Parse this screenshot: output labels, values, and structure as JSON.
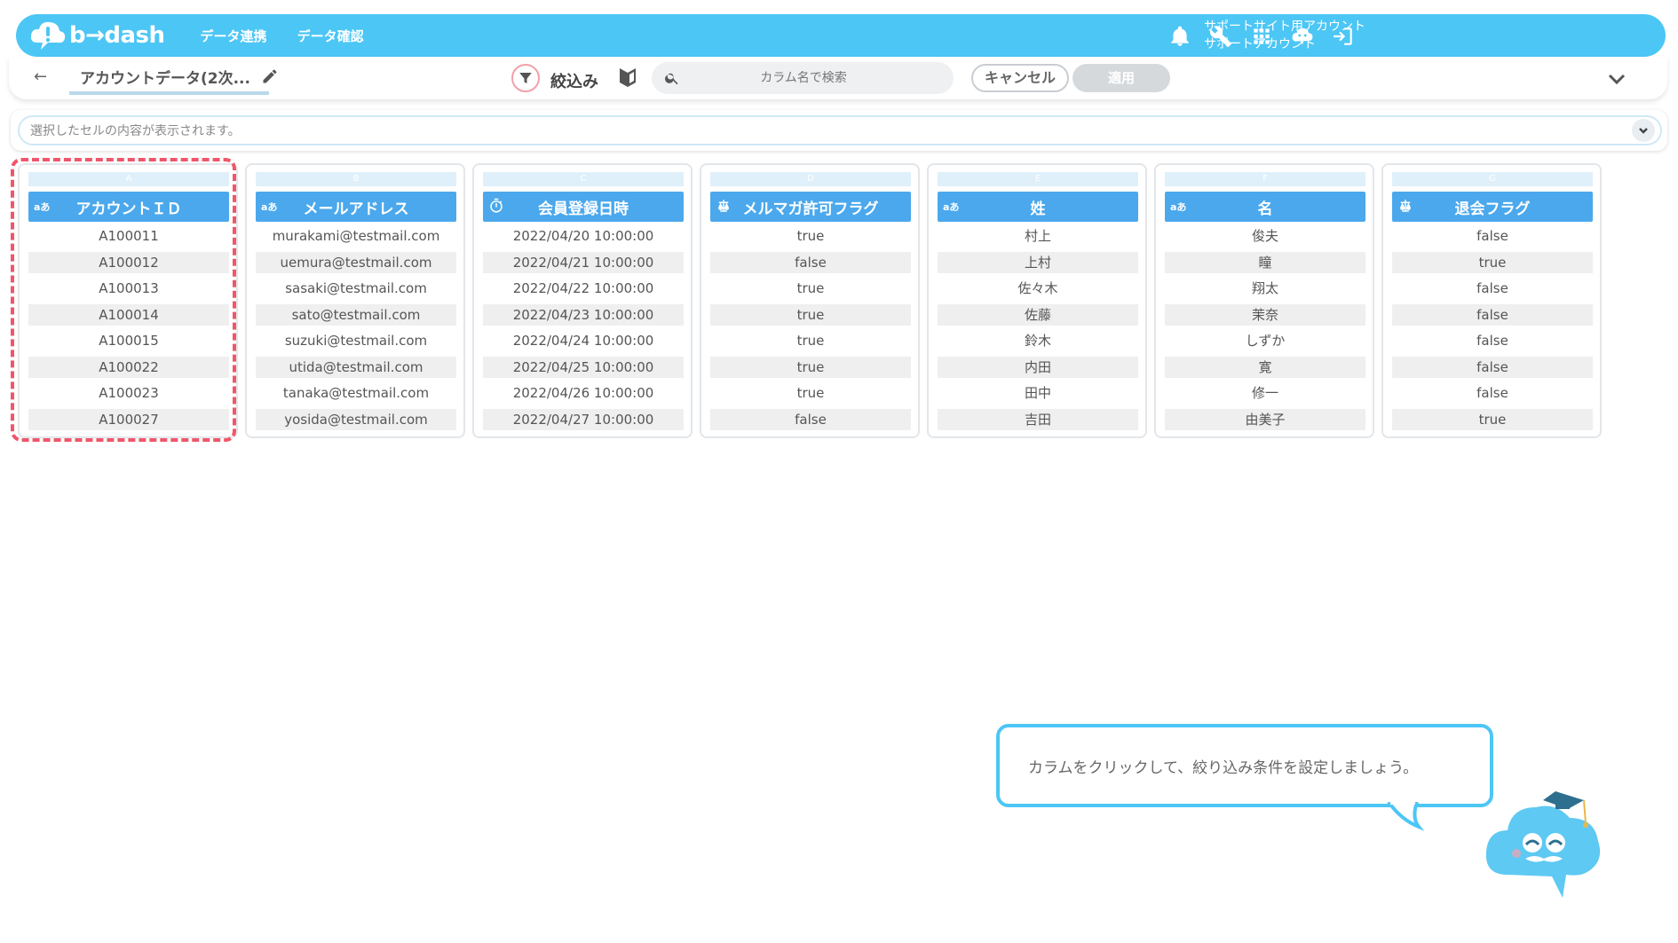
{
  "app": {
    "logo_text": "b→dash",
    "nav": [
      "データ連携",
      "データ確認"
    ],
    "account_line1": "サポートサイト用アカウント",
    "account_line2": "サポートアカウント"
  },
  "toolbar": {
    "back": "←",
    "title": "アカウントデータ(2次...",
    "filter_label": "絞込み",
    "search_placeholder": "カラム名で検索",
    "cancel_label": "キャンセル",
    "apply_label": "適用"
  },
  "cellbar": {
    "placeholder": "選択したセルの内容が表示されます。"
  },
  "columns": [
    {
      "letter": "A",
      "type": "aあ",
      "name": "アカウントＩＤ",
      "cells": [
        "A100011",
        "A100012",
        "A100013",
        "A100014",
        "A100015",
        "A100022",
        "A100023",
        "A100027"
      ]
    },
    {
      "letter": "B",
      "type": "aあ",
      "name": "メールアドレス",
      "cells": [
        "murakami@testmail.com",
        "uemura@testmail.com",
        "sasaki@testmail.com",
        "sato@testmail.com",
        "suzuki@testmail.com",
        "utida@testmail.com",
        "tanaka@testmail.com",
        "yosida@testmail.com"
      ]
    },
    {
      "letter": "C",
      "type": "clock",
      "name": "会員登録日時",
      "cells": [
        "2022/04/20 10:00:00",
        "2022/04/21 10:00:00",
        "2022/04/22 10:00:00",
        "2022/04/23 10:00:00",
        "2022/04/24 10:00:00",
        "2022/04/25 10:00:00",
        "2022/04/26 10:00:00",
        "2022/04/27 10:00:00"
      ]
    },
    {
      "letter": "D",
      "type": "scale",
      "name": "メルマガ許可フラグ",
      "cells": [
        "true",
        "false",
        "true",
        "true",
        "true",
        "true",
        "true",
        "false"
      ]
    },
    {
      "letter": "E",
      "type": "aあ",
      "name": "姓",
      "cells": [
        "村上",
        "上村",
        "佐々木",
        "佐藤",
        "鈴木",
        "内田",
        "田中",
        "吉田"
      ]
    },
    {
      "letter": "F",
      "type": "aあ",
      "name": "名",
      "cells": [
        "俊夫",
        "瞳",
        "翔太",
        "茉奈",
        "しずか",
        "寛",
        "修一",
        "由美子"
      ]
    },
    {
      "letter": "G",
      "type": "scale",
      "name": "退会フラグ",
      "cells": [
        "false",
        "true",
        "false",
        "false",
        "false",
        "false",
        "false",
        "true"
      ]
    }
  ],
  "tutorial": {
    "message": "カラムをクリックして、絞り込み条件を設定しましょう。"
  },
  "colors": {
    "brand": "#4cc6f5",
    "header": "#4ba8ec",
    "selection": "#f0566a"
  }
}
